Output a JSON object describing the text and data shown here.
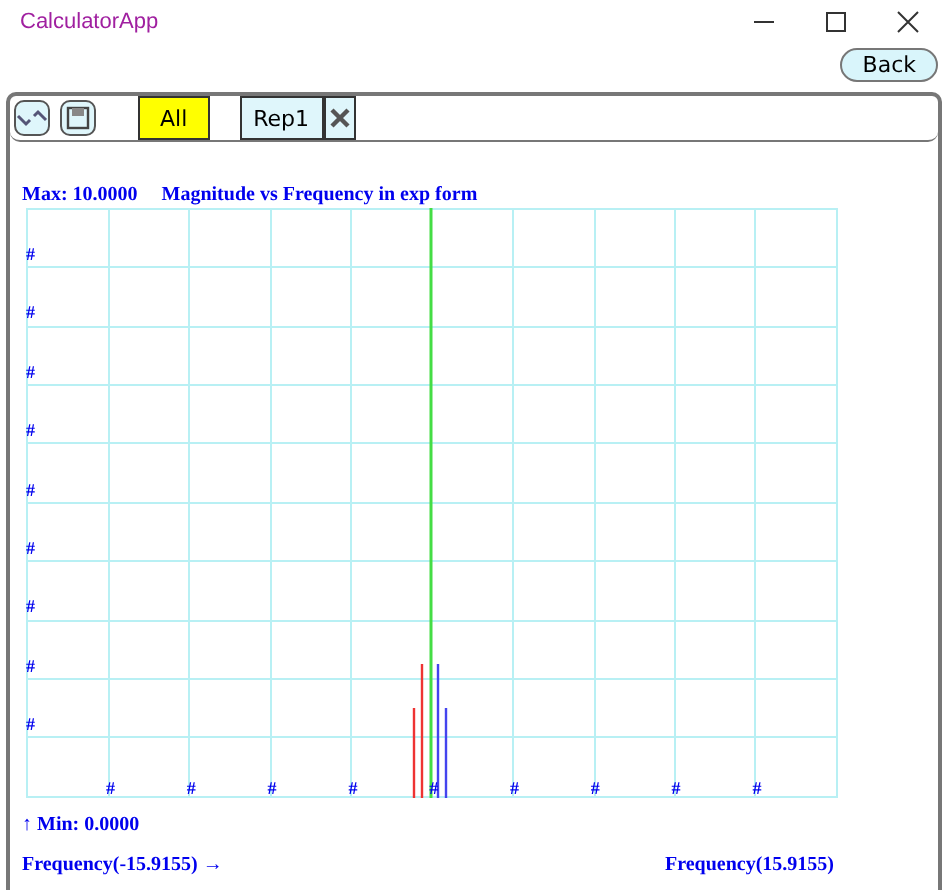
{
  "window": {
    "title": "CalculatorApp"
  },
  "back_button": "Back",
  "toolbar": {
    "tabs": [
      {
        "label": "All",
        "selected": true
      },
      {
        "label": "Rep1",
        "selected": false
      }
    ]
  },
  "plot": {
    "max_label": "Max: 10.0000",
    "title": "Magnitude vs Frequency in exp form",
    "y_marks": [
      "#",
      "#",
      "#",
      "#",
      "#",
      "#",
      "#",
      "#",
      "#"
    ],
    "x_marks": [
      "#",
      "#",
      "#",
      "#",
      "#",
      "#",
      "#",
      "#",
      "#"
    ],
    "min_label": "↑ Min: 0.0000",
    "freq_start": "Frequency(-15.9155) →",
    "freq_end": "Frequency(15.9155)"
  }
}
